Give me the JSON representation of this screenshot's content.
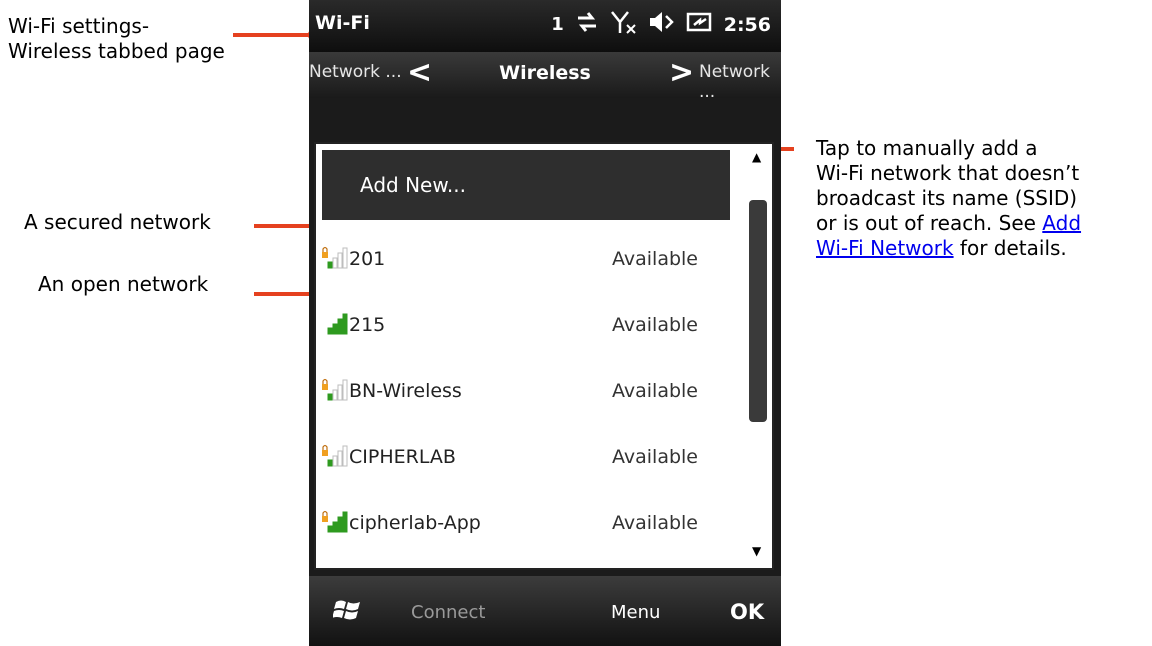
{
  "annotations": {
    "wifi_settings": [
      "Wi-Fi settings-",
      "Wireless tabbed page"
    ],
    "secured": "A secured network",
    "open": "An open network",
    "add_new_note": {
      "line1": "Tap to manually add a",
      "line2": "Wi-Fi network that doesn’t",
      "line3": "broadcast its name (SSID)",
      "line4_prefix": "or is out of reach. See ",
      "link_part1": "Add",
      "link_part2": "Wi-Fi Network",
      "line5_suffix": " for details."
    },
    "accent_color": "#e5411f"
  },
  "status_bar": {
    "title": "Wi-Fi",
    "signal_indicator": "1",
    "time": "2:56",
    "icons": [
      "data-sync-icon",
      "no-signal-icon",
      "volume-muted-icon",
      "battery-charging-icon"
    ]
  },
  "tabs": {
    "left": "Network ...",
    "current": "Wireless",
    "right": "Network ..."
  },
  "list": {
    "add_new": "Add New...",
    "networks": [
      {
        "ssid": "201",
        "status": "Available",
        "secured": true,
        "strength": 1
      },
      {
        "ssid": "215",
        "status": "Available",
        "secured": false,
        "strength": 4
      },
      {
        "ssid": "BN-Wireless",
        "status": "Available",
        "secured": true,
        "strength": 1
      },
      {
        "ssid": "CIPHERLAB",
        "status": "Available",
        "secured": true,
        "strength": 1
      },
      {
        "ssid": "cipherlab-App",
        "status": "Available",
        "secured": true,
        "strength": 4
      }
    ]
  },
  "softkeys": {
    "left": "Connect",
    "menu": "Menu",
    "ok": "OK"
  }
}
